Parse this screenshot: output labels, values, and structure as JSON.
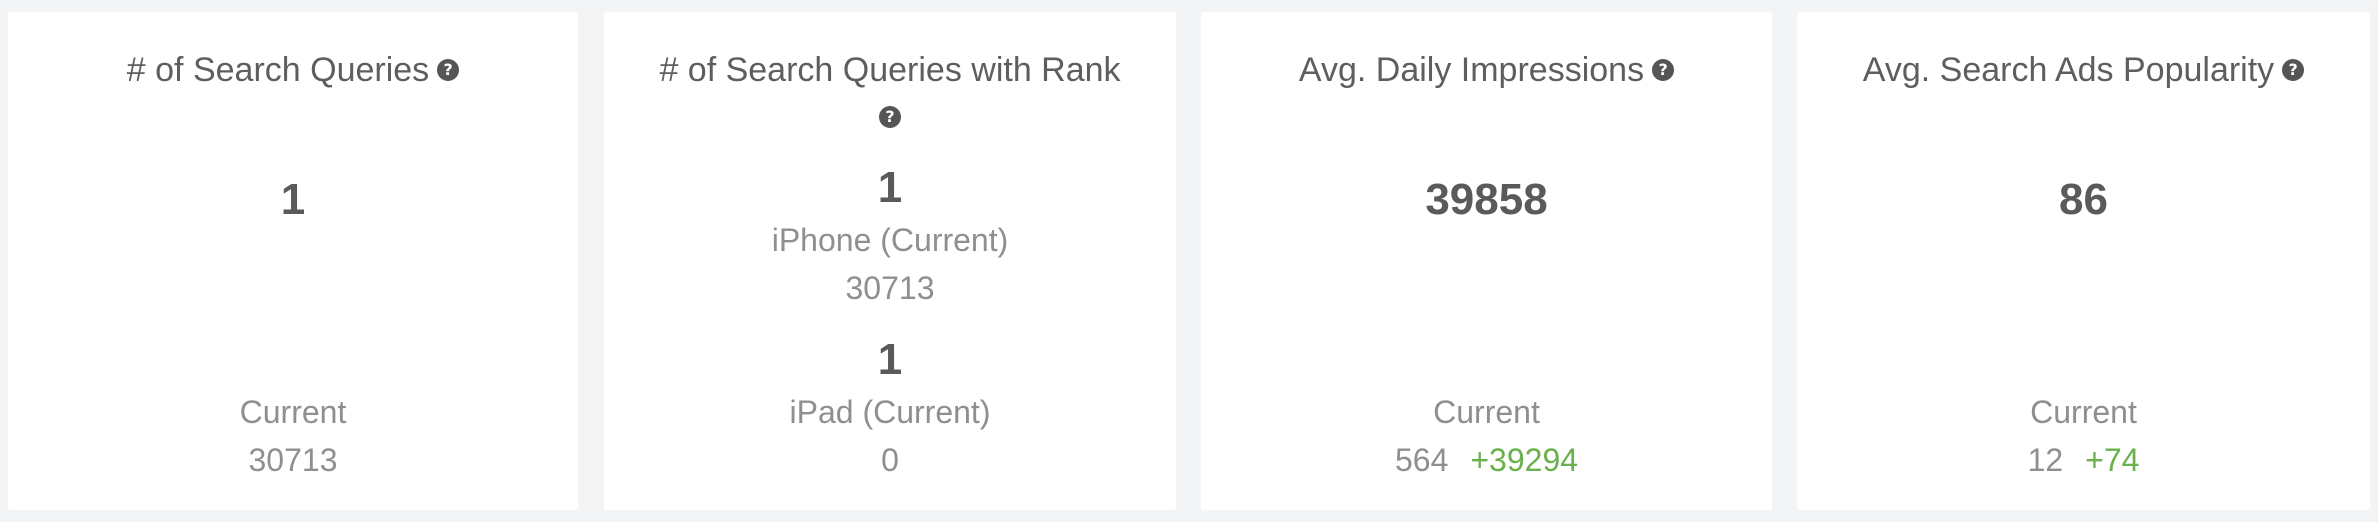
{
  "cards": [
    {
      "title": "# of Search Queries",
      "help_icon": "?",
      "value": "1",
      "footer_label": "Current",
      "footer_value": "30713"
    },
    {
      "title_line1": "# of Search Queries with Rank",
      "help_icon": "?",
      "iphone": {
        "value": "1",
        "label": "iPhone (Current)",
        "sub_value": "30713"
      },
      "ipad": {
        "value": "1",
        "label": "iPad (Current)",
        "sub_value": "0"
      }
    },
    {
      "title": "Avg. Daily Impressions",
      "help_icon": "?",
      "value": "39858",
      "footer_label": "Current",
      "footer_value": "564",
      "footer_delta": "+39294"
    },
    {
      "title": "Avg. Search Ads Popularity",
      "help_icon": "?",
      "value": "86",
      "footer_label": "Current",
      "footer_value": "12",
      "footer_delta": "+74"
    }
  ],
  "colors": {
    "background": "#f3f4f6",
    "card": "#ffffff",
    "title_text": "#5e5e5e",
    "muted_text": "#8f8f8f",
    "positive_delta": "#6ab04c",
    "help_icon_bg": "#555555"
  }
}
